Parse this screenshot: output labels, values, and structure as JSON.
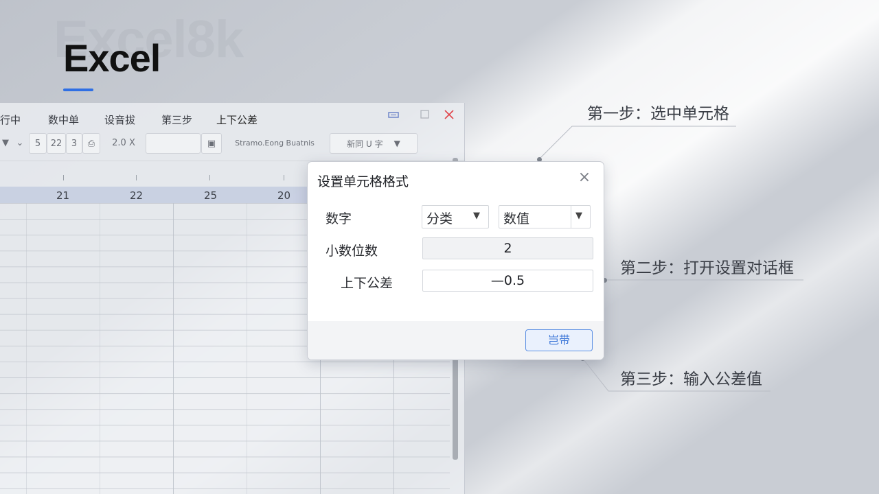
{
  "watermark": "Excel8k",
  "page_title": "Excel",
  "excel": {
    "menu": [
      "行中",
      "数中单",
      "设音拔",
      "第三步",
      "上下公差"
    ],
    "toolbar": {
      "nums": [
        "5",
        "22",
        "3"
      ],
      "value_box": "2.0 X",
      "font_name": "Stramo.Eong Buatnis",
      "dropdown_text": "新同 U 字"
    },
    "columns": [
      "21",
      "22",
      "25",
      "20"
    ]
  },
  "dialog": {
    "title": "设置单元格格式",
    "row1_label": "数字",
    "category_label": "分类",
    "category_value": "数值",
    "decimal_label": "小数位数",
    "decimal_value": "2",
    "tolerance_label": "上下公差",
    "tolerance_value": "—0.5",
    "ok_label": "岂带"
  },
  "notes": {
    "step1": "第一步：选中单元格",
    "step2": "第二步：打开设置对话框",
    "step3": "第三步：输入公差值"
  },
  "colors": {
    "accent": "#2f6fe4",
    "ok_text": "#3d77d8",
    "close_red": "#e0444a"
  }
}
